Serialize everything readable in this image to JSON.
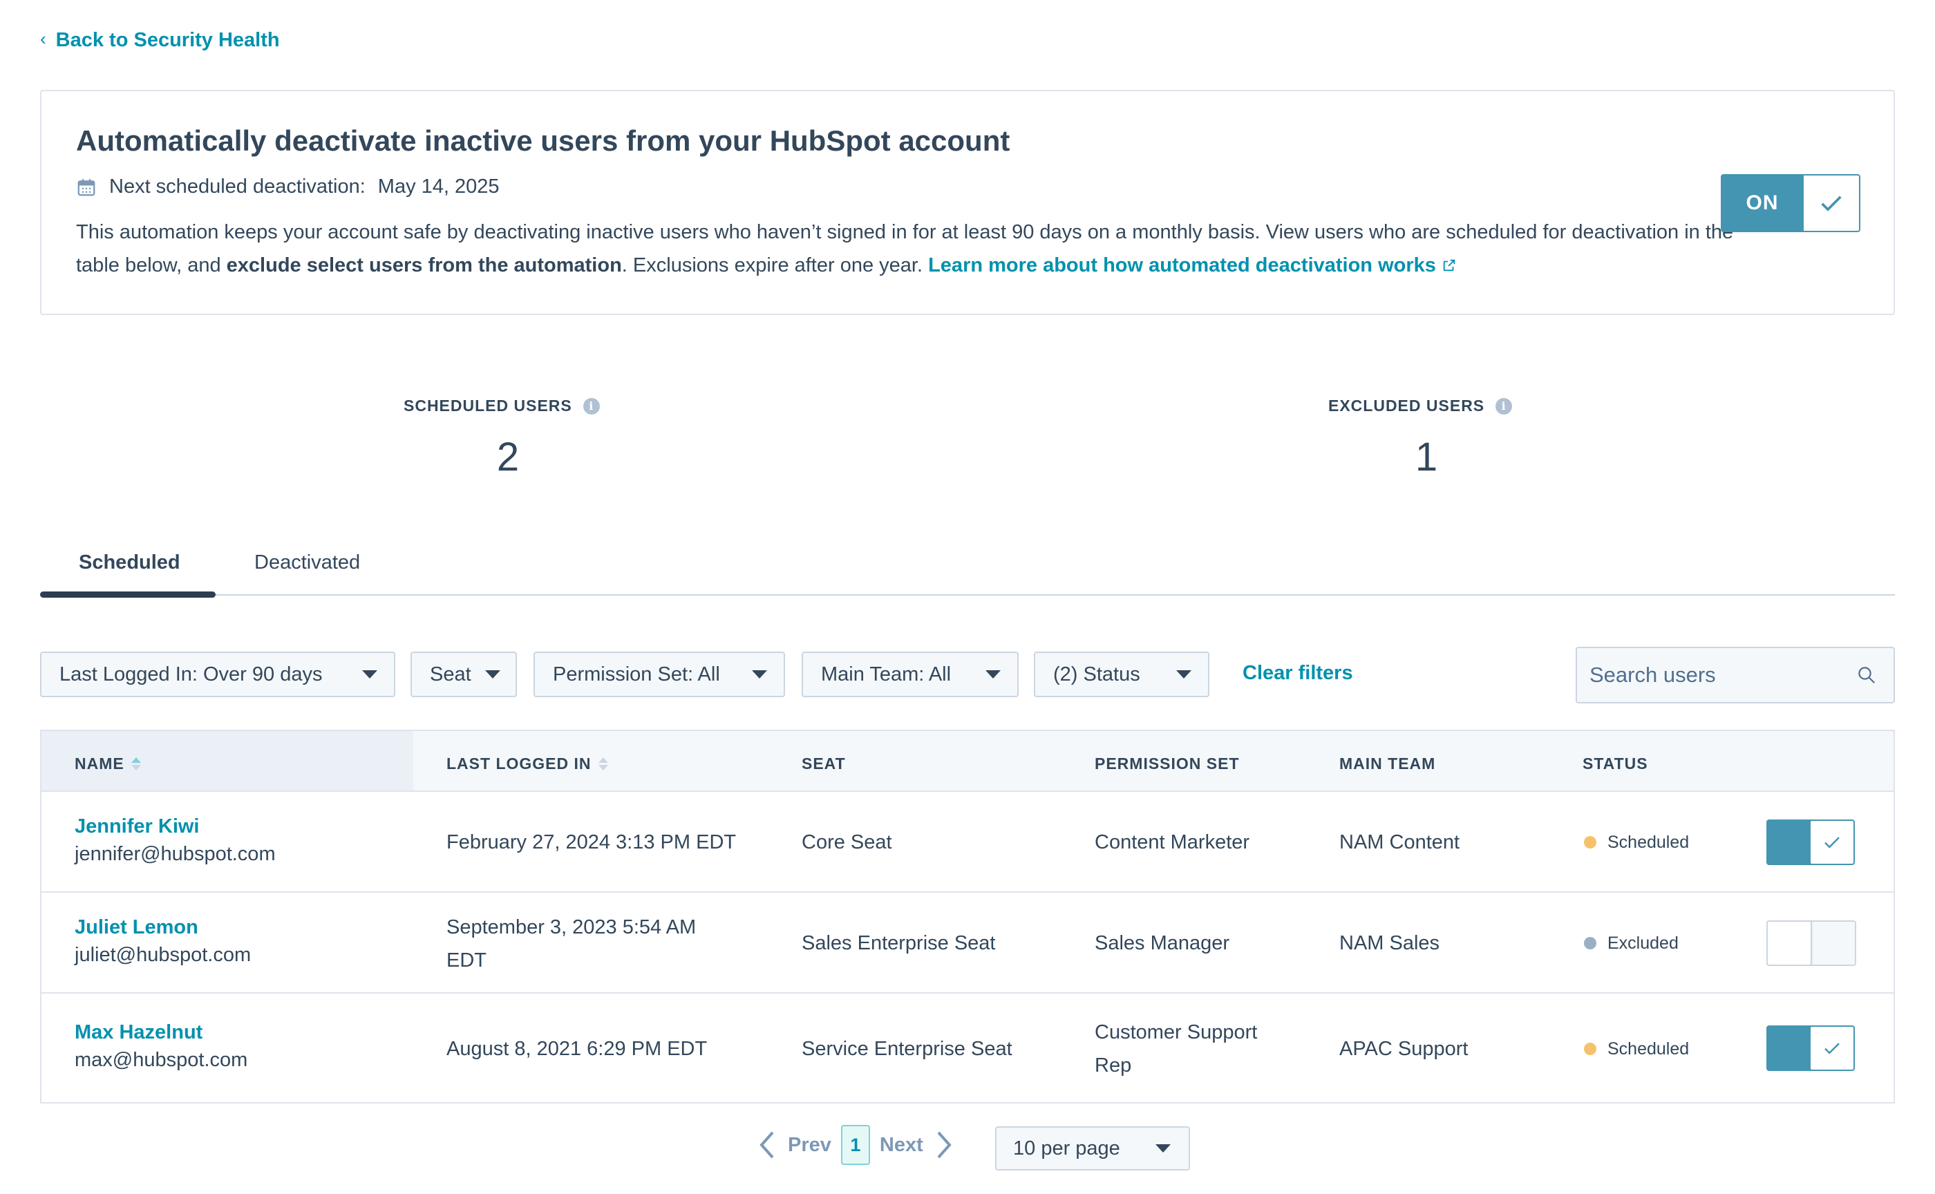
{
  "back_link": "Back to Security Health",
  "automation": {
    "title": "Automatically deactivate inactive users from your HubSpot account",
    "next_label": "Next scheduled deactivation:",
    "next_date": "May 14, 2025",
    "desc_part1": "This automation keeps your account safe by deactivating inactive users who haven’t signed in for at least 90 days on a monthly basis. View users who are scheduled for deactivation in the table below, and ",
    "desc_bold": "exclude select users from the automation",
    "desc_part2": ". Exclusions expire after one year. ",
    "learn_link": "Learn more about how automated deactivation works",
    "toggle_label": "ON",
    "toggle_on": true
  },
  "stats": {
    "scheduled_label": "SCHEDULED USERS",
    "scheduled_value": "2",
    "excluded_label": "EXCLUDED USERS",
    "excluded_value": "1"
  },
  "tabs": [
    {
      "label": "Scheduled",
      "active": true
    },
    {
      "label": "Deactivated",
      "active": false
    }
  ],
  "filters": {
    "last_logged": "Last Logged In: Over 90 days",
    "seat": "Seat",
    "permission": "Permission Set: All",
    "team": "Main Team: All",
    "status": "(2) Status",
    "clear": "Clear filters",
    "search_placeholder": "Search users"
  },
  "table": {
    "headers": {
      "name": "NAME",
      "last_logged": "LAST LOGGED IN",
      "seat": "SEAT",
      "permission": "PERMISSION SET",
      "team": "MAIN TEAM",
      "status": "STATUS"
    },
    "rows": [
      {
        "name": "Jennifer Kiwi",
        "email": "jennifer@hubspot.com",
        "last_logged": "February 27, 2024 3:13 PM EDT",
        "seat": "Core Seat",
        "permission": "Content Marketer",
        "team": "NAM Content",
        "status": "Scheduled",
        "status_color": "#f5c26b",
        "toggle_on": true
      },
      {
        "name": "Juliet Lemon",
        "email": "juliet@hubspot.com",
        "last_logged": "September 3, 2023 5:54 AM EDT",
        "seat": "Sales Enterprise Seat",
        "permission": "Sales Manager",
        "team": "NAM Sales",
        "status": "Excluded",
        "status_color": "#99afc4",
        "toggle_on": false
      },
      {
        "name": "Max Hazelnut",
        "email": "max@hubspot.com",
        "last_logged": "August 8, 2021 6:29 PM EDT",
        "seat": "Service Enterprise Seat",
        "permission": "Customer Support Rep",
        "team": "APAC Support",
        "status": "Scheduled",
        "status_color": "#f5c26b",
        "toggle_on": true
      }
    ]
  },
  "pagination": {
    "prev": "Prev",
    "page": "1",
    "next": "Next",
    "per_page": "10 per page"
  },
  "colors": {
    "accent": "#0091ae",
    "toggle": "#4495b1",
    "text": "#33475b"
  }
}
